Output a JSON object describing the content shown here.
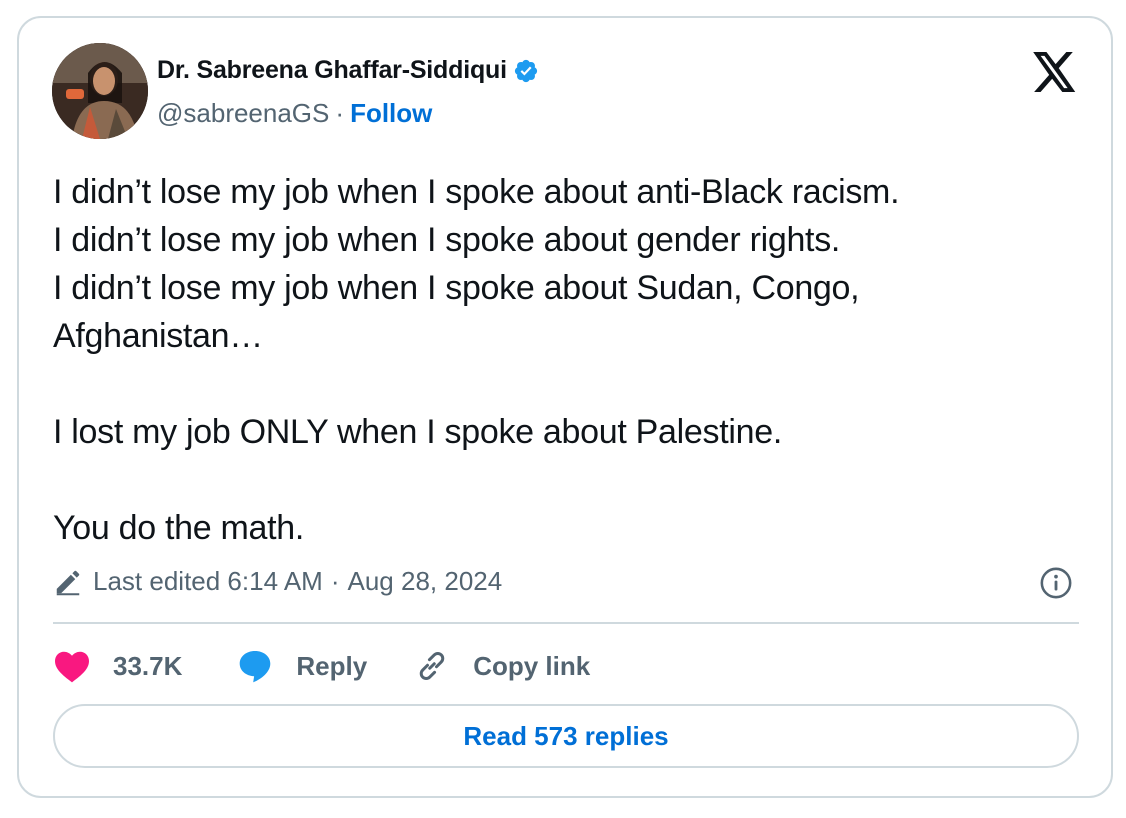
{
  "author": {
    "name": "Dr. Sabreena Ghaffar-Siddiqui",
    "handle": "@sabreenaGS",
    "separator": "·",
    "follow_label": "Follow",
    "verified_icon": "verified-badge-icon",
    "verified_color": "#1d9bf0"
  },
  "brand_icon": "x-logo-icon",
  "tweet": {
    "text": "I didn’t lose my job when I spoke about anti-Black racism.\nI didn’t lose my job when I spoke about gender rights.\nI didn’t lose my job when I spoke about Sudan, Congo,\nAfghanistan…\n\nI lost my job ONLY when I spoke about Palestine.\n\nYou do the math."
  },
  "meta": {
    "edited_label": "Last edited 6:14 AM",
    "separator": "·",
    "date": "Aug 28, 2024",
    "edit_icon": "pencil-icon",
    "info_icon": "info-icon"
  },
  "actions": {
    "like_count": "33.7K",
    "like_color": "#f91880",
    "reply_label": "Reply",
    "reply_color": "#1d9bf0",
    "copy_label": "Copy link"
  },
  "read_replies_label": "Read 573 replies",
  "colors": {
    "text": "#0f1419",
    "secondary": "#536471",
    "link": "#006fd6",
    "border": "#cfd9de"
  }
}
